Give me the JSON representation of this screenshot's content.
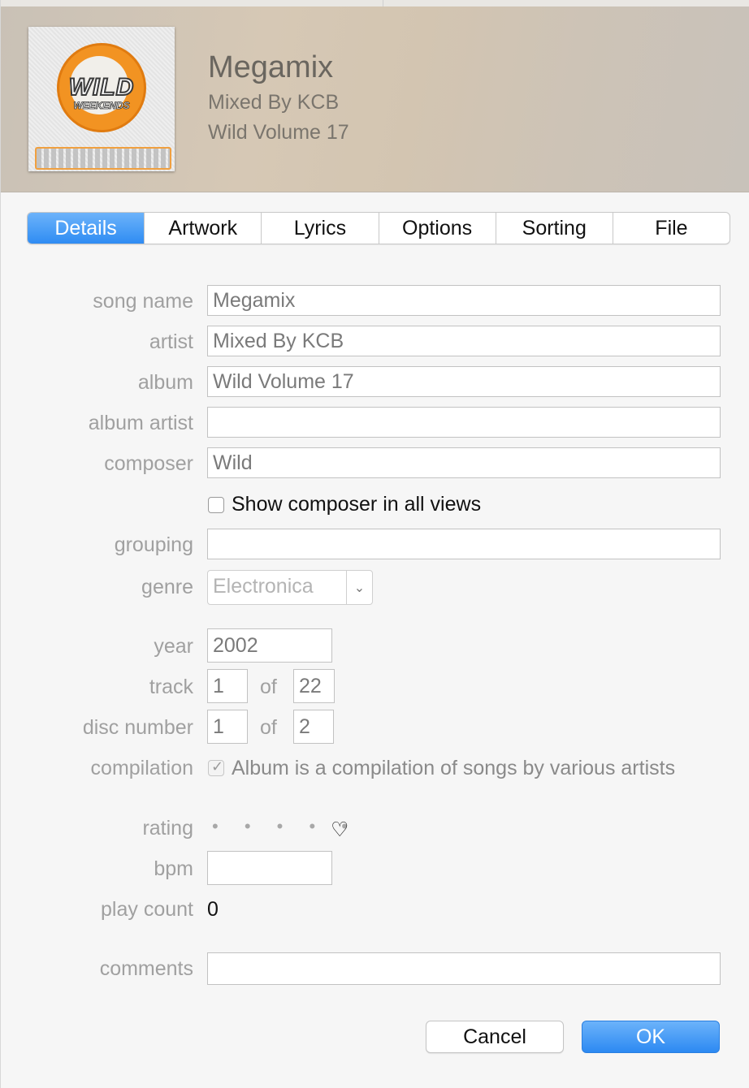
{
  "header": {
    "title": "Megamix",
    "artist": "Mixed By KCB",
    "album": "Wild Volume 17",
    "artwork_text": {
      "main": "WILD",
      "sub": "WEEKENDS"
    }
  },
  "tabs": [
    {
      "label": "Details",
      "active": true
    },
    {
      "label": "Artwork",
      "active": false
    },
    {
      "label": "Lyrics",
      "active": false
    },
    {
      "label": "Options",
      "active": false
    },
    {
      "label": "Sorting",
      "active": false
    },
    {
      "label": "File",
      "active": false
    }
  ],
  "fields": {
    "song_name": {
      "label": "song name",
      "value": "Megamix"
    },
    "artist": {
      "label": "artist",
      "value": "Mixed By KCB"
    },
    "album": {
      "label": "album",
      "value": "Wild Volume 17"
    },
    "album_artist": {
      "label": "album artist",
      "value": ""
    },
    "composer": {
      "label": "composer",
      "value": "Wild"
    },
    "show_composer": {
      "label": "Show composer in all views",
      "checked": false
    },
    "grouping": {
      "label": "grouping",
      "value": ""
    },
    "genre": {
      "label": "genre",
      "value": "Electronica"
    },
    "year": {
      "label": "year",
      "value": "2002"
    },
    "track": {
      "label": "track",
      "number": "1",
      "of_label": "of",
      "total": "22"
    },
    "disc": {
      "label": "disc number",
      "number": "1",
      "of_label": "of",
      "total": "2"
    },
    "compilation": {
      "label": "compilation",
      "text": "Album is a compilation of songs by various artists",
      "checked": true
    },
    "rating": {
      "label": "rating",
      "stars": 0,
      "dots": "• • • • •",
      "heart": "♡"
    },
    "bpm": {
      "label": "bpm",
      "value": ""
    },
    "play_count": {
      "label": "play count",
      "value": "0"
    },
    "comments": {
      "label": "comments",
      "value": ""
    }
  },
  "buttons": {
    "cancel": "Cancel",
    "ok": "OK"
  },
  "colors": {
    "accent": "#2f8cf3",
    "label": "#a0a0a0"
  }
}
